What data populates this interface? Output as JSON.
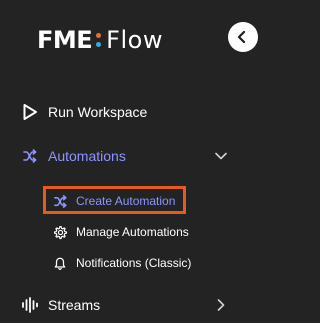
{
  "logo": {
    "part1": "FME",
    "part2": "Flow",
    "dot_colors": [
      "#e8702a",
      "#3aa9e3"
    ]
  },
  "nav": {
    "run_workspace": {
      "label": "Run Workspace",
      "icon": "play-outline-icon"
    },
    "automations": {
      "label": "Automations",
      "icon": "shuffle-icon",
      "expanded": true,
      "accent_color": "#8c95ff",
      "children": [
        {
          "label": "Create Automation",
          "icon": "shuffle-icon",
          "active": true,
          "highlighted": true
        },
        {
          "label": "Manage Automations",
          "icon": "gear-icon"
        },
        {
          "label": "Notifications (Classic)",
          "icon": "bell-icon"
        }
      ]
    },
    "streams": {
      "label": "Streams",
      "icon": "audio-wave-icon"
    }
  },
  "highlight_color": "#e65a1e"
}
